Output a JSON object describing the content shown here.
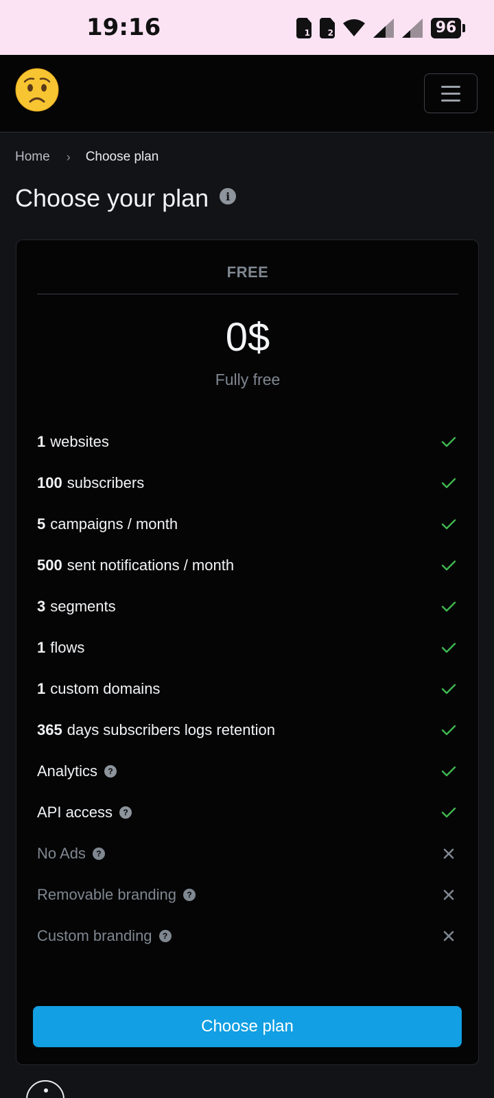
{
  "status_bar": {
    "time": "19:16",
    "sim1": "1",
    "sim2": "2",
    "battery": "96"
  },
  "navbar": {
    "logo_icon": "worried-face-emoji",
    "menu_icon": "hamburger-menu-icon"
  },
  "breadcrumb": {
    "home": "Home",
    "separator": "›",
    "current": "Choose plan"
  },
  "page": {
    "title": "Choose your plan",
    "title_icon": "i"
  },
  "plan": {
    "name": "FREE",
    "price": "0$",
    "subtitle": "Fully free",
    "features": [
      {
        "count": "1",
        "label": "websites",
        "included": true
      },
      {
        "count": "100",
        "label": "subscribers",
        "included": true
      },
      {
        "count": "5",
        "label": "campaigns / month",
        "included": true
      },
      {
        "count": "500",
        "label": "sent notifications / month",
        "included": true
      },
      {
        "count": "3",
        "label": "segments",
        "included": true
      },
      {
        "count": "1",
        "label": "flows",
        "included": true
      },
      {
        "count": "1",
        "label": "custom domains",
        "included": true
      },
      {
        "count": "365",
        "label": "days subscribers logs retention",
        "included": true
      },
      {
        "count": "",
        "label": "Analytics",
        "help": "?",
        "included": true
      },
      {
        "count": "",
        "label": "API access",
        "help": "?",
        "included": true
      },
      {
        "count": "",
        "label": "No Ads",
        "help": "?",
        "included": false
      },
      {
        "count": "",
        "label": "Removable branding",
        "help": "?",
        "included": false
      },
      {
        "count": "",
        "label": "Custom branding",
        "help": "?",
        "included": false
      }
    ],
    "button_label": "Choose plan"
  },
  "colors": {
    "check": "#3fb950",
    "cross": "#7f8790",
    "accent": "#129fe3"
  }
}
